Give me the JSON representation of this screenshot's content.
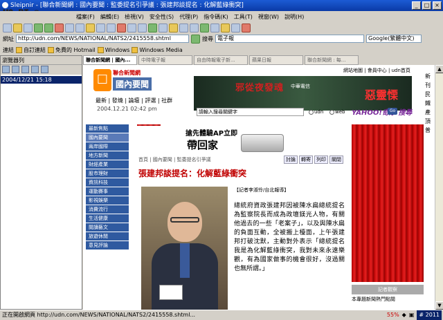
{
  "window": {
    "title": "Sleipnir - [聯合新聞網 : 國內要聞 : 監委提名引爭議 : 張建邦談提名 : 化解藍綠衝突]",
    "watermark": "MO BI ®"
  },
  "menu": [
    "檔案(F)",
    "編輯(E)",
    "檢視(V)",
    "安全性(S)",
    "代理(P)",
    "指令碼(K)",
    "工具(T)",
    "視窗(W)",
    "說明(H)"
  ],
  "address": {
    "label": "網址",
    "url": "http://udn.com/NEWS/NATIONAL/NATS2/2415558.shtml",
    "search_label": "搜尋",
    "search_value": "電子報",
    "engine": "Google(繁體中文)"
  },
  "links": {
    "label": "連結",
    "items": [
      "自訂連結",
      "免費的 Hotmail",
      "Windows",
      "Windows Media"
    ]
  },
  "panel": {
    "title": "瀏覽器列",
    "history_item": "2004/12/21 15:18"
  },
  "tabs": [
    "聯合新聞網 | 國內...",
    "中時電子報",
    "自由時報電子新...",
    "蘋果日報",
    "聯合新聞網 : 每..."
  ],
  "site": {
    "logo_top": "聯合新聞網",
    "logo_main": "國內要聞",
    "toplinks": "網站地圖 | 會員中心 | udn首頁",
    "nav": "最新 | 發燒 | 論壇 | 評選 | 社群",
    "date": "2004.12.21 02:42 pm",
    "banner_title": "邪從夜發魂",
    "banner_sub": "中華電信",
    "banner_right": "惡靈慄",
    "search_placeholder": "請輸入搜尋關鍵字",
    "radio_udn": "udn",
    "radio_web": "web",
    "yahoo": "YAHOO!奇摩 搜尋",
    "go": "Go",
    "sidenav": [
      "最新焦點",
      "國內要聞",
      "兩岸國際",
      "地方新聞",
      "財經產業",
      "股市理財",
      "資訊科技",
      "運動賽事",
      "影視娛樂",
      "消費流行",
      "生活健康",
      "閱讀藝文",
      "旅遊休閒",
      "意見評論"
    ],
    "ad_line1": "搶先體驗AP立即",
    "ad_line2": "帶回家",
    "breadcrumb": "首頁 | 國內要聞 | 監委提名引爭議",
    "tools": [
      "討論",
      "轉寄",
      "列印",
      "關閉"
    ],
    "headline": "張建邦談提名：化解藍綠衝突",
    "byline": "【記者李淑伶/台北報導】",
    "article": "總統府資政張建邦因被陳水扁總統提名為監察院長而成為政壇鎂光人物，有關他過去的一些「老案子」，以及與陳水扁的負面互動，全被搬上檯面，上午張建邦打破沈默，主動對外表示「總統提名我是為化解藍綠衝突，我對未來永遠樂觀，有為國家做事的機會很好，沒過關也無所謂。」",
    "sidebox": "記者觀察",
    "sidebox2": "本專題新聞熱門點閱",
    "rightcol": [
      "新",
      "刊",
      "民",
      "",
      "鐵",
      "產",
      "",
      "頂",
      "普"
    ]
  },
  "status": {
    "text": "正在開啟網頁 http://udn.com/NEWS/NATIONAL/NATS2/2415558.shtml...",
    "percent": "55%",
    "badge": "# 2011"
  }
}
